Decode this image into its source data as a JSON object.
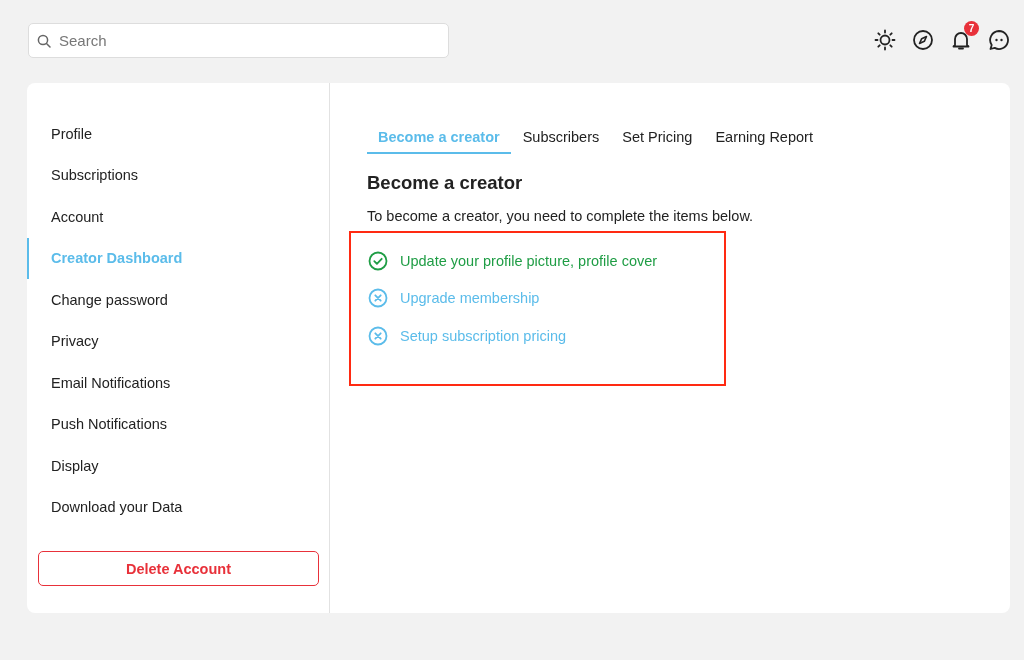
{
  "search": {
    "placeholder": "Search"
  },
  "header": {
    "notification_count": "7"
  },
  "sidebar": {
    "items": [
      {
        "label": "Profile",
        "selected": false
      },
      {
        "label": "Subscriptions",
        "selected": false
      },
      {
        "label": "Account",
        "selected": false
      },
      {
        "label": "Creator Dashboard",
        "selected": true
      },
      {
        "label": "Change password",
        "selected": false
      },
      {
        "label": "Privacy",
        "selected": false
      },
      {
        "label": "Email Notifications",
        "selected": false
      },
      {
        "label": "Push Notifications",
        "selected": false
      },
      {
        "label": "Display",
        "selected": false
      },
      {
        "label": "Download your Data",
        "selected": false
      }
    ],
    "delete_button": "Delete Account"
  },
  "tabs": [
    {
      "label": "Become a creator",
      "selected": true
    },
    {
      "label": "Subscribers",
      "selected": false
    },
    {
      "label": "Set Pricing",
      "selected": false
    },
    {
      "label": "Earning Report",
      "selected": false
    }
  ],
  "heading": "Become a creator",
  "description": "To become a creator, you need to complete the items below.",
  "requirements": [
    {
      "label": "Update your profile picture, profile cover",
      "done": true
    },
    {
      "label": "Upgrade membership",
      "done": false
    },
    {
      "label": "Setup subscription pricing",
      "done": false
    }
  ]
}
